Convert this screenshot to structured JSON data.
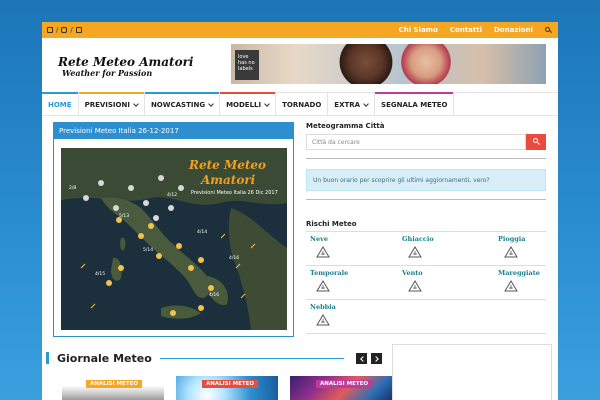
{
  "topbar": {
    "links": [
      "Chi Siamo",
      "Contatti",
      "Donazioni"
    ]
  },
  "header": {
    "logo_title": "Rete Meteo Amatori",
    "logo_subtitle": "Weather for Passion",
    "banner_text": "love has no labels"
  },
  "nav": {
    "items": [
      {
        "label": "HOME",
        "bar": "#2a9ad6",
        "dropdown": false
      },
      {
        "label": "PREVISIONI",
        "bar": "#f5a623",
        "dropdown": true
      },
      {
        "label": "NOWCASTING",
        "bar": "#2a9ad6",
        "dropdown": true
      },
      {
        "label": "MODELLI",
        "bar": "#e74c3c",
        "dropdown": true
      },
      {
        "label": "TORNADO",
        "bar": "",
        "dropdown": false
      },
      {
        "label": "EXTRA",
        "bar": "",
        "dropdown": true
      },
      {
        "label": "SEGNALA METEO",
        "bar": "#c0399b",
        "dropdown": false
      }
    ]
  },
  "forecast": {
    "header": "Previsioni Meteo Italia 26-12-2017",
    "map_title_1": "Rete Meteo",
    "map_title_2": "Amatori",
    "map_subtitle": "Previsioni Meteo Italia 26 Dic 2017",
    "map_labels": [
      "4/12",
      "5/13",
      "4/14",
      "5/14",
      "4/16",
      "4/15",
      "4/16",
      "2/8"
    ]
  },
  "right": {
    "meteogram_title": "Meteogramma Città",
    "search_placeholder": "Città da cercare",
    "alert_text": "Un buon orario per scoprire gli ultimi aggiornamenti, vero?",
    "risk_title": "Rischi Meteo",
    "risks": [
      [
        "Neve",
        "Ghiaccio",
        "Pioggia"
      ],
      [
        "Temporale",
        "Vento",
        "Mareggiate"
      ],
      [
        "Nebbia"
      ]
    ]
  },
  "giornale": {
    "title": "Giornale Meteo",
    "cards": [
      {
        "badge": "ANALISI METEO",
        "badge_color": "#f5a623"
      },
      {
        "badge": "ANALISI METEO",
        "badge_color": "#e74c3c"
      },
      {
        "badge": "ANALISI METEO",
        "badge_color": "#c0399b"
      }
    ]
  },
  "colors": {
    "accent": "#2a9ad6",
    "topbar": "#f5a623",
    "search_button": "#e74c3c"
  }
}
